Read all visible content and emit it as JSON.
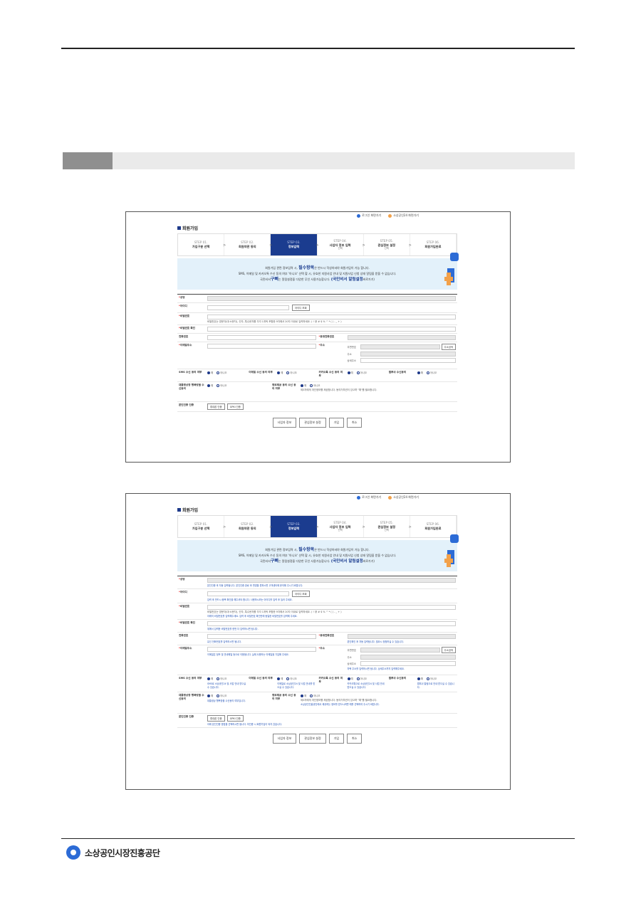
{
  "top_nav": {
    "login_label": "로그인 화면가기",
    "site_label": "소상공인24 화면가기"
  },
  "page_title": "회원가입",
  "steps": [
    {
      "step": "STEP 01.",
      "label": "가입구분 선택",
      "sub": ""
    },
    {
      "step": "STEP 02.",
      "label": "회원약관 동의",
      "sub": ""
    },
    {
      "step": "STEP 03.",
      "label": "정보입력",
      "sub": ""
    },
    {
      "step": "STEP 04.",
      "label": "사업자 정보 입력",
      "sub": "선택"
    },
    {
      "step": "STEP 05.",
      "label": "관심정보 설정",
      "sub": "선택"
    },
    {
      "step": "STEP 06.",
      "label": "회원가입완료",
      "sub": ""
    }
  ],
  "notice": {
    "line1_pre": "회원가입 관련 정보입력 시,",
    "line1_em": "필수항목",
    "line1_post": "은 반드시 작성하셔야 회원가입이 가능 합니다.",
    "line2": "SMS, 이메일 및 카카오톡 수신 동의 여부 '아니오' 선택 할 시, 유효한 지원사업 안내 및 지원사업 신청 상태 알림을 받을 수 없습니다.",
    "line3_pre": "국민비서",
    "line3_em": "구삐",
    "line3_mid": "는 알림설정을 다양한 무인 사용가능합니다.",
    "line3_big": "(국민비서 알림설정",
    "line3_post": "바로가기)"
  },
  "form": {
    "name": "성명",
    "id": "아이디",
    "id_check": "아이디 조회",
    "password": "비밀번호",
    "password_rule": "비밀번호는 영문자(대·소문자), 숫자, 특수문자를 각각 1개씩 포함한 9자에서 20자 이내로 입력하세요. ( ! @ # $ % ^ * ( ) - _ + )",
    "password_confirm": "비밀번호 확인",
    "phone": "전화번호",
    "mobile": "휴대전화번호",
    "email": "이메일주소",
    "address": "주소",
    "zip": "우편번호",
    "addr_search": "주소검색",
    "addr_main": "주소",
    "addr_detail": "상세주소",
    "sms": "SMS 수신 동의 여부",
    "email_agree": "이메일 수신 동의 여부",
    "kakao": "카카오톡 수신 동의 여부",
    "push": "앱푸쉬 수신동의",
    "yes": "예",
    "no": "아니오",
    "gov_alert": "대통령상장 행복방울 수신동의",
    "personal_info": "정보제공 동의 수신 동의 여부",
    "personal_note": "제3자에게 개인정보를 제공합니다. 동의거부권이 있으며 \"예\"를 필요합니다.",
    "verify": "본인인증 인증",
    "verify_phone": "휴대폰 인증",
    "verify_gpin": "GPKI 인증"
  },
  "hints_b": {
    "name": "본인인증 후 자동 입력됩니다. 본인인증 완료 후 변경을 원하시면 고객센터에 문의해 주시기 바랍니다.",
    "id": "입력 후 반드시 중복 확인을 해주셔야 합니다. 사용하시려는 아이디를 입력 후 눌러 주세요.",
    "password": "아래의 비밀번호를 입력해주세요. 입력 후 비밀번호 확인란에 동일한 비밀번호를 입력해 주세요.",
    "password_confirm": "위에서 입력한 비밀번호를 한번 더 입력하시면 됩니다.",
    "phone": "유선 전화번호를 입력하시면 됩니다.",
    "mobile": "본인확인 후 자동 입력됩니다. 필요시 정정하실 수 있습니다.",
    "email": "이메일은 정보 및 안내메일 등으로 이용됩니다. 실제 사용하는 이메일을 기입해 주세요.",
    "address": "자택 주소를 입력하시면 됩니다. 상세주소까지 입력해주세요.",
    "sms": "SMS로 소상공인24 및 사업 안내 받으실 수 있습니다.",
    "email_agree": "이메일로 소상공인24 및 사업 안내를 받으실 수 있습니다.",
    "kakao": "카카오톡으로 소상공인24 및 사업 안내 받으실 수 있습니다.",
    "push": "앱푸쉬 알림으로 안내 받으실 수 있습니다.",
    "gov_alert": "대통령상 행복방울 수신동의 여부입니다.",
    "personal": "소상공인진흥공단에서 제공하는 정보를 받으시려면 예를 선택하여 주시기 바랍니다.",
    "verify": "아래 본인인증 방법을 선택하시면 됩니다. 미인증 시 회원가입이 되지 않습니다."
  },
  "actions": {
    "biz": "사업자 정보",
    "interest": "관심정보 설정",
    "join": "가입",
    "cancel": "취소"
  },
  "footer": {
    "org": "소상공인시장진흥공단"
  },
  "colors": {
    "navy": "#1b3c8f",
    "notice_bg": "#e3f1fa",
    "accent_orange": "#f2a14a",
    "accent_blue": "#2c6bd6"
  }
}
